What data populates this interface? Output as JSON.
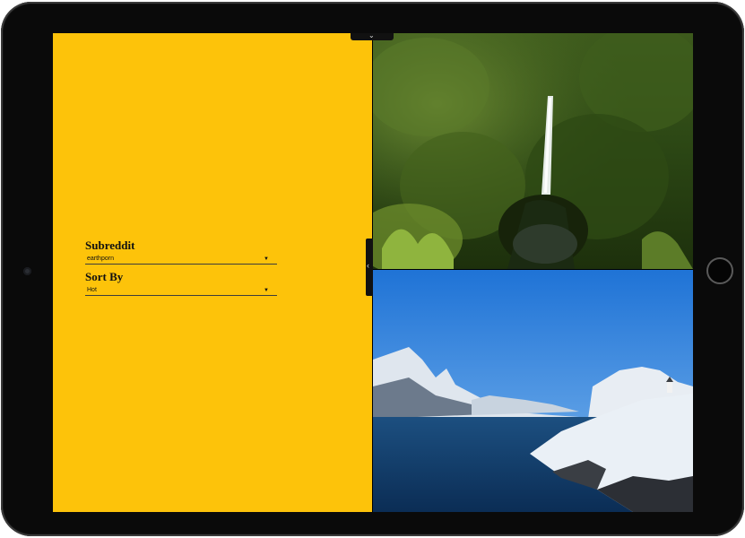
{
  "settings": {
    "subreddit_label": "Subreddit",
    "subreddit_value": "earthporn",
    "sort_label": "Sort By",
    "sort_value": "Hot"
  },
  "icons": {
    "dropdown": "▼",
    "sidebar_toggle": "‹",
    "top_toggle": "⌄"
  },
  "colors": {
    "panel_background": "#fdc30a",
    "device_bezel": "#0a0a0a"
  },
  "photos": [
    {
      "subject": "waterfall-forest"
    },
    {
      "subject": "snowy-mountains-fjord"
    }
  ]
}
